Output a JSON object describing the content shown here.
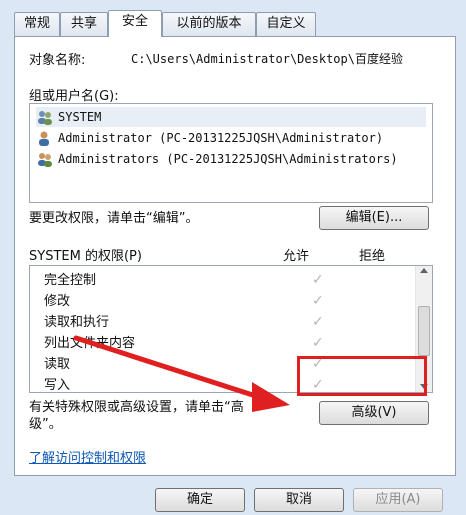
{
  "tabs": [
    "常规",
    "共享",
    "安全",
    "以前的版本",
    "自定义"
  ],
  "object_label": "对象名称:",
  "object_path": "C:\\Users\\Administrator\\Desktop\\百度经验",
  "group_label": "组或用户名(G):",
  "users": [
    "SYSTEM",
    "Administrator (PC-20131225JQSH\\Administrator)",
    "Administrators (PC-20131225JQSH\\Administrators)"
  ],
  "change_hint": "要更改权限，请单击“编辑”。",
  "edit_button": "编辑(E)...",
  "perm_header": "SYSTEM 的权限(P)",
  "allow_label": "允许",
  "deny_label": "拒绝",
  "permissions": [
    "完全控制",
    "修改",
    "读取和执行",
    "列出文件夹内容",
    "读取",
    "写入"
  ],
  "check_glyph": "✓",
  "special_hint_line1": "有关特殊权限或高级设置，请单击“高",
  "special_hint_line2": "级”。",
  "advanced_button": "高级(V)",
  "learn_link": "了解访问控制和权限",
  "footer": {
    "ok": "确定",
    "cancel": "取消",
    "apply": "应用(A)"
  },
  "colors": {
    "highlight": "#e02020",
    "link": "#0d57b5"
  }
}
